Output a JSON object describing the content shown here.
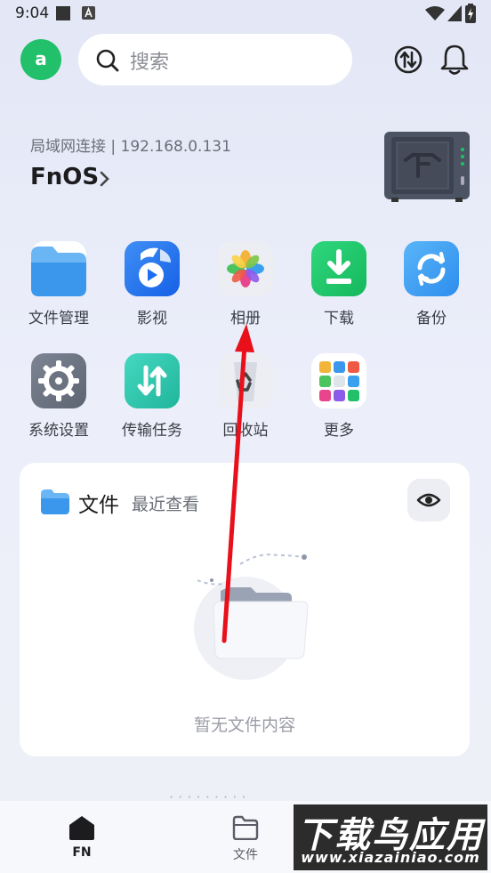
{
  "status_bar": {
    "time": "9:04"
  },
  "header": {
    "avatar_letter": "a",
    "search_placeholder": "搜索"
  },
  "device": {
    "connection": "局域网连接 | 192.168.0.131",
    "name": "FnOS"
  },
  "apps": [
    {
      "label": "文件管理",
      "icon": "folder-icon"
    },
    {
      "label": "影视",
      "icon": "movie-icon"
    },
    {
      "label": "相册",
      "icon": "photos-icon"
    },
    {
      "label": "下载",
      "icon": "download-icon"
    },
    {
      "label": "备份",
      "icon": "backup-icon"
    },
    {
      "label": "系统设置",
      "icon": "settings-icon"
    },
    {
      "label": "传输任务",
      "icon": "transfer-icon"
    },
    {
      "label": "回收站",
      "icon": "recycle-bin-icon"
    },
    {
      "label": "更多",
      "icon": "more-apps-icon"
    }
  ],
  "files_card": {
    "title": "文件",
    "subtitle": "最近查看",
    "empty_text": "暂无文件内容"
  },
  "bottom_nav": [
    {
      "label": "FN",
      "icon": "home-icon",
      "active": true
    },
    {
      "label": "文件",
      "icon": "folder-outline-icon",
      "active": false
    }
  ],
  "watermark": {
    "title": "下载鸟应用",
    "url": "www.xiazainiao.com"
  },
  "colors": {
    "accent_green": "#22c06b",
    "arrow_red": "#e8101b",
    "page_bg": "#e9ecf8"
  }
}
